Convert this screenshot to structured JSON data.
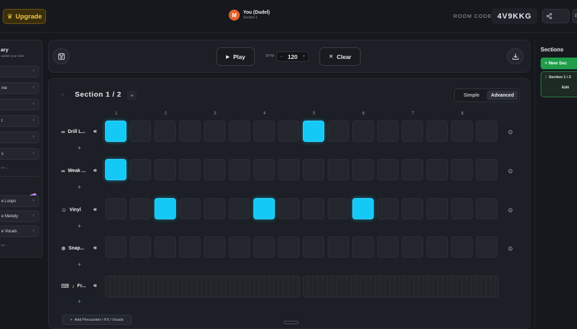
{
  "header": {
    "upgrade_label": "Upgrade",
    "user_initial": "M",
    "user_name": "You (Dudel)",
    "user_subtitle": "Section 1",
    "room_code_label": "ROOM CODE:",
    "room_code": "4V9KKG",
    "share_label": "",
    "p_label": "P"
  },
  "library": {
    "title": "ary",
    "subtitle": "update your beat",
    "items": [
      {
        "label": ""
      },
      {
        "label": "me"
      },
      {
        "label": ""
      },
      {
        "label": "t"
      },
      {
        "label": ""
      },
      {
        "label": "s"
      }
    ],
    "more_label": "ore →",
    "items2": [
      {
        "label": "e Loops"
      },
      {
        "label": "e Melody"
      },
      {
        "label": "e Vocals"
      }
    ],
    "more2_label": "ore →"
  },
  "transport": {
    "play_label": "Play",
    "bpm_label": "BPM",
    "bpm_value": "120",
    "clear_label": "Clear"
  },
  "sequencer": {
    "section_title": "Section 1 / 2",
    "mode_simple": "Simple",
    "mode_advanced": "Advanced",
    "beat_numbers": [
      "1",
      "2",
      "3",
      "4",
      "5",
      "6",
      "7",
      "8"
    ],
    "tracks": [
      {
        "name": "Drill L...",
        "icon": "loop-icon",
        "steps": [
          1,
          0,
          0,
          0,
          0,
          0,
          0,
          0,
          1,
          0,
          0,
          0,
          0,
          0,
          0,
          0
        ]
      },
      {
        "name": "Weak ...",
        "icon": "loop-icon",
        "steps": [
          1,
          0,
          0,
          0,
          0,
          0,
          0,
          0,
          0,
          0,
          0,
          0,
          0,
          0,
          0,
          0
        ]
      },
      {
        "name": "Vinyl",
        "icon": "cat-icon",
        "steps": [
          0,
          0,
          1,
          0,
          0,
          0,
          1,
          0,
          0,
          0,
          1,
          0,
          0,
          0,
          0,
          0
        ]
      },
      {
        "name": "Snap...",
        "icon": "snap-icon",
        "steps": [
          0,
          0,
          0,
          0,
          0,
          0,
          0,
          0,
          0,
          0,
          0,
          0,
          0,
          0,
          0,
          0
        ]
      }
    ],
    "melody_track": {
      "name": "Fr...",
      "icon": "piano-icon"
    },
    "add_percussion_label": "Add Percussion / FX / Vocals",
    "active_color": "#14c9f5"
  },
  "sections_panel": {
    "title": "Sections",
    "new_section_label": "+ New Sec",
    "card_title": "Section 1 / 2",
    "card_edit": "Edit"
  }
}
